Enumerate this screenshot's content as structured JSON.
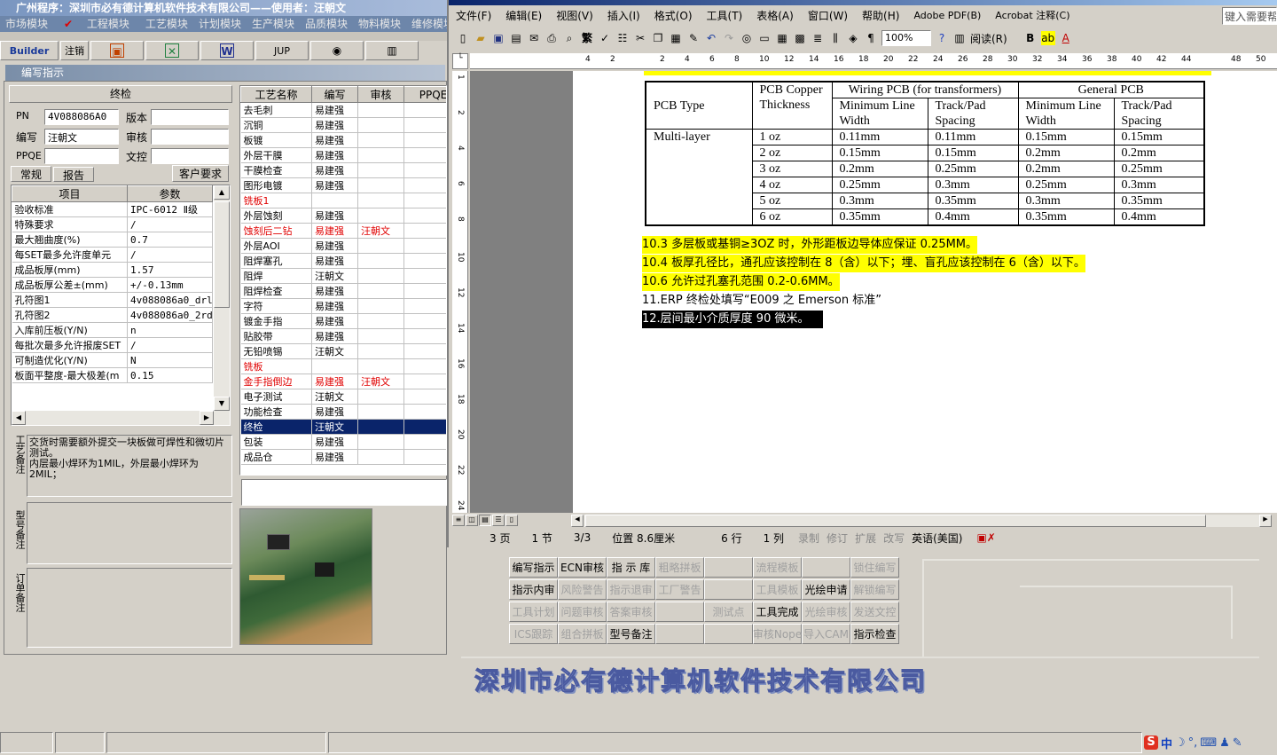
{
  "erp": {
    "title": "广州程序：深圳市必有德计算机软件技术有限公司——使用者：汪朝文",
    "menu": [
      "市场模块",
      "工程模块",
      "工艺模块",
      "计划模块",
      "生产模块",
      "品质模块",
      "物料模块",
      "维修模块"
    ],
    "toolbar": [
      "Builder",
      "注销",
      "",
      "",
      "W",
      "JUP",
      "",
      ""
    ],
    "form_title": "编写指示",
    "section_title": "终检",
    "pn_label": "PN",
    "pn_value": "4V088086A0",
    "version_label": "版本",
    "version_value": "",
    "writer_label": "编写",
    "writer_value": "汪朝文",
    "review_label": "审核",
    "review_value": "",
    "ppqe_label": "PPQE",
    "ppqe_value": "",
    "doc_label": "文控",
    "doc_value": "",
    "tabs": [
      "常规",
      "报告"
    ],
    "customer_req": "客户要求",
    "params_headers": [
      "项目",
      "参数"
    ],
    "params": [
      [
        "验收标准",
        "IPC-6012 Ⅱ级"
      ],
      [
        "特殊要求",
        "/"
      ],
      [
        "最大翘曲度(%)",
        "0.7"
      ],
      [
        "每SET最多允许度单元",
        "/"
      ],
      [
        "成品板厚(mm)",
        "1.57"
      ],
      [
        "成品板厚公差±(mm)",
        "+/-0.13mm"
      ],
      [
        "孔符图1",
        "4v088086a0_drl"
      ],
      [
        "孔符图2",
        "4v088086a0_2rd"
      ],
      [
        "入库前压板(Y/N)",
        "n"
      ],
      [
        "每批次最多允许报废SET",
        "/"
      ],
      [
        "可制造优化(Y/N)",
        "N"
      ],
      [
        "板面平整度-最大极差(m",
        "0.15"
      ]
    ],
    "process_headers": [
      "工艺名称",
      "编写",
      "审核",
      "PPQE"
    ],
    "processes": [
      {
        "name": "去毛刺",
        "writer": "易建强",
        "review": "",
        "red": false,
        "sel": false
      },
      {
        "name": "沉铜",
        "writer": "易建强",
        "review": "",
        "red": false,
        "sel": false
      },
      {
        "name": "板镀",
        "writer": "易建强",
        "review": "",
        "red": false,
        "sel": false
      },
      {
        "name": "外层干膜",
        "writer": "易建强",
        "review": "",
        "red": false,
        "sel": false
      },
      {
        "name": "干膜检查",
        "writer": "易建强",
        "review": "",
        "red": false,
        "sel": false
      },
      {
        "name": "图形电镀",
        "writer": "易建强",
        "review": "",
        "red": false,
        "sel": false
      },
      {
        "name": "铣板1",
        "writer": "",
        "review": "",
        "red": true,
        "sel": false
      },
      {
        "name": "外层蚀刻",
        "writer": "易建强",
        "review": "",
        "red": false,
        "sel": false
      },
      {
        "name": "蚀刻后二钻",
        "writer": "易建强",
        "review": "汪朝文",
        "red": true,
        "sel": false
      },
      {
        "name": "外层AOI",
        "writer": "易建强",
        "review": "",
        "red": false,
        "sel": false
      },
      {
        "name": "阻焊塞孔",
        "writer": "易建强",
        "review": "",
        "red": false,
        "sel": false
      },
      {
        "name": "阻焊",
        "writer": "汪朝文",
        "review": "",
        "red": false,
        "sel": false
      },
      {
        "name": "阻焊检查",
        "writer": "易建强",
        "review": "",
        "red": false,
        "sel": false
      },
      {
        "name": "字符",
        "writer": "易建强",
        "review": "",
        "red": false,
        "sel": false
      },
      {
        "name": "镀金手指",
        "writer": "易建强",
        "review": "",
        "red": false,
        "sel": false
      },
      {
        "name": "贴胶带",
        "writer": "易建强",
        "review": "",
        "red": false,
        "sel": false
      },
      {
        "name": "无铅喷锡",
        "writer": "汪朝文",
        "review": "",
        "red": false,
        "sel": false
      },
      {
        "name": "铣板",
        "writer": "",
        "review": "",
        "red": true,
        "sel": false
      },
      {
        "name": "金手指倒边",
        "writer": "易建强",
        "review": "汪朝文",
        "red": true,
        "sel": false
      },
      {
        "name": "电子测试",
        "writer": "汪朝文",
        "review": "",
        "red": false,
        "sel": false
      },
      {
        "name": "功能检查",
        "writer": "易建强",
        "review": "",
        "red": false,
        "sel": false
      },
      {
        "name": "终检",
        "writer": "汪朝文",
        "review": "",
        "red": false,
        "sel": true
      },
      {
        "name": "包装",
        "writer": "易建强",
        "review": "",
        "red": false,
        "sel": false
      },
      {
        "name": "成品仓",
        "writer": "易建强",
        "review": "",
        "red": false,
        "sel": false
      }
    ],
    "process_note_label": "工艺备注",
    "process_note": "交货时需要额外提交一块板做可焊性和微切片测试。\n内层最小焊环为1MIL，外层最小焊环为2MIL；",
    "model_note_label": "型号备注",
    "order_note_label": "订单备注",
    "buttons": [
      {
        "label": "编写指示",
        "dis": false
      },
      {
        "label": "ECN审核",
        "dis": false
      },
      {
        "label": "指 示 库",
        "dis": false
      },
      {
        "label": "粗略拼板",
        "dis": true
      },
      {
        "label": "",
        "dis": true
      },
      {
        "label": "流程模板",
        "dis": true
      },
      {
        "label": "",
        "dis": true
      },
      {
        "label": "锁住编写",
        "dis": true
      },
      {
        "label": "指示内审",
        "dis": false
      },
      {
        "label": "风险警告",
        "dis": true
      },
      {
        "label": "指示退审",
        "dis": true
      },
      {
        "label": "工厂警告",
        "dis": true
      },
      {
        "label": "",
        "dis": true
      },
      {
        "label": "工具模板",
        "dis": true
      },
      {
        "label": "光绘申请",
        "dis": false
      },
      {
        "label": "解锁编写",
        "dis": true
      },
      {
        "label": "工具计划",
        "dis": true
      },
      {
        "label": "问题审核",
        "dis": true
      },
      {
        "label": "答案审核",
        "dis": true
      },
      {
        "label": "",
        "dis": true
      },
      {
        "label": "测试点",
        "dis": true
      },
      {
        "label": "工具完成",
        "dis": false
      },
      {
        "label": "光绘审核",
        "dis": true
      },
      {
        "label": "发送文控",
        "dis": true
      },
      {
        "label": "ICS跟踪",
        "dis": true
      },
      {
        "label": "组合拼板",
        "dis": true
      },
      {
        "label": "型号备注",
        "dis": false
      },
      {
        "label": "",
        "dis": true
      },
      {
        "label": "",
        "dis": true
      },
      {
        "label": "审核Nope",
        "dis": true
      },
      {
        "label": "导入CAM",
        "dis": true
      },
      {
        "label": "指示检查",
        "dis": false
      }
    ],
    "banner": "深圳市必有德计算机软件技术有限公司"
  },
  "word": {
    "menu": [
      "文件(F)",
      "编辑(E)",
      "视图(V)",
      "插入(I)",
      "格式(O)",
      "工具(T)",
      "表格(A)",
      "窗口(W)",
      "帮助(H)",
      "Adobe PDF(B)",
      "Acrobat 注释(C)"
    ],
    "help_box": "键入需要帮",
    "zoom": "100%",
    "read_label": "阅读(R)",
    "ruler": [
      "4",
      "2",
      "",
      "2",
      "4",
      "6",
      "8",
      "10",
      "12",
      "14",
      "16",
      "18",
      "20",
      "22",
      "24",
      "26",
      "28",
      "30",
      "32",
      "34",
      "36",
      "38",
      "40",
      "42",
      "44",
      "",
      "48",
      "50"
    ],
    "vruler": [
      "1",
      "2",
      "4",
      "6",
      "8",
      "10",
      "12",
      "14",
      "16",
      "18",
      "20",
      "22",
      "24"
    ],
    "table": {
      "h_pcb_type": "PCB Type",
      "h_copper": "PCB Copper Thickness",
      "h_wiring": "Wiring PCB (for  transformers)",
      "h_general": "General  PCB",
      "h_min_line": "Minimum Line Width",
      "h_spacing": "Track/Pad Spacing",
      "h_min_line2": "Minimum Line Width",
      "h_spacing2": "Track/Pad Spacing",
      "type": "Multi-layer",
      "rows": [
        [
          "1 oz",
          "0.11mm",
          "0.11mm",
          "0.15mm",
          "0.15mm"
        ],
        [
          "2 oz",
          "0.15mm",
          "0.15mm",
          "0.2mm",
          "0.2mm"
        ],
        [
          "3 oz",
          "0.2mm",
          "0.25mm",
          "0.2mm",
          "0.25mm"
        ],
        [
          "4 oz",
          "0.25mm",
          "0.3mm",
          "0.25mm",
          "0.3mm"
        ],
        [
          "5 oz",
          "0.3mm",
          "0.35mm",
          "0.3mm",
          "0.35mm"
        ],
        [
          "6 oz",
          "0.35mm",
          "0.4mm",
          "0.35mm",
          "0.4mm"
        ]
      ]
    },
    "lines": [
      "10.3 多层板或基铜≥3OZ 时，外形距板边导体应保证 0.25MM。",
      "10.4 板厚孔径比，通孔应该控制在 8（含）以下；埋、盲孔应该控制在 6（含）以下。",
      "10.6 允许过孔塞孔范围 0.2-0.6MM。",
      "11.ERP 终检处填写“E009 之 Emerson 标准”",
      "12.层间最小介质厚度 90 微米。"
    ],
    "status": [
      "3 页",
      "1 节",
      "3/3",
      "位置 8.6厘米",
      "6 行",
      "1 列",
      "录制",
      "修订",
      "扩展",
      "改写",
      "英语(美国)"
    ]
  },
  "taskbar": {
    "ime": "中"
  }
}
